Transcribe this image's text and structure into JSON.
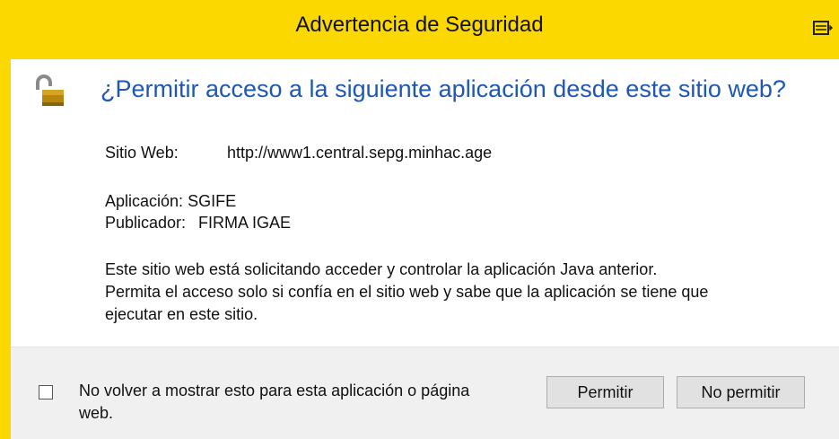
{
  "window": {
    "title": "Advertencia de Seguridad",
    "title_icon": "restore-window-icon",
    "accent_color": "#fbd800"
  },
  "content": {
    "lock_icon": "unlocked-padlock-icon",
    "question": "¿Permitir acceso a la siguiente aplicación desde este sitio web?",
    "website_label": "Sitio Web:",
    "website_value": "http://www1.central.sepg.minhac.age",
    "application_label": "Aplicación:",
    "application_value": "SGIFE",
    "publisher_label": "Publicador:",
    "publisher_value": "FIRMA IGAE",
    "message_line1": "Este sitio web está solicitando acceder y controlar la aplicación Java anterior.",
    "message_line2": "Permita el acceso solo si confía en el sitio web y sabe que la aplicación se tiene que",
    "message_line3": "ejecutar en este sitio."
  },
  "footer": {
    "checkbox_checked": false,
    "checkbox_label": "No volver a mostrar esto para esta aplicación o página web.",
    "allow_button": "Permitir",
    "deny_button": "No permitir"
  }
}
